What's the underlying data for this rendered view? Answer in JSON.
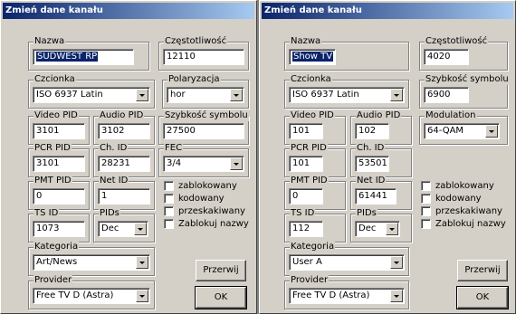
{
  "left": {
    "title": "Zmień dane kanału",
    "labels": {
      "nazwa": "Nazwa",
      "freq": "Częstotliwość",
      "czcionka": "Czcionka",
      "polar": "Polaryzacja",
      "video_pid": "Video PID",
      "audio_pid": "Audio PID",
      "symbol": "Szybkość symbolu",
      "pcr_pid": "PCR PID",
      "ch_id": "Ch. ID",
      "fec": "FEC",
      "pmt_pid": "PMT PID",
      "net_id": "Net ID",
      "ts_id": "TS ID",
      "pids": "PIDs",
      "kategoria": "Kategoria",
      "provider": "Provider"
    },
    "values": {
      "nazwa": "SÜDWEST RP",
      "freq": "12110",
      "czcionka": "ISO 6937 Latin",
      "polar": "hor",
      "video_pid": "3101",
      "audio_pid": "3102",
      "symbol": "27500",
      "pcr_pid": "3101",
      "ch_id": "28231",
      "fec": "3/4",
      "pmt_pid": "0",
      "net_id": "1",
      "ts_id": "1073",
      "pids": "Dec",
      "kategoria": "Art/News",
      "provider": "Free TV D (Astra)"
    },
    "checks": [
      "zablokowany",
      "kodowany",
      "przeskakiwany",
      "Zablokuj nazwy"
    ],
    "buttons": {
      "cancel": "Przerwij",
      "ok": "OK"
    }
  },
  "right": {
    "title": "Zmień dane kanału",
    "labels": {
      "nazwa": "Nazwa",
      "freq": "Częstotliwość",
      "czcionka": "Czcionka",
      "symbol": "Szybkość symbolu",
      "video_pid": "Video PID",
      "audio_pid": "Audio PID",
      "modulation": "Modulation",
      "pcr_pid": "PCR PID",
      "ch_id": "Ch. ID",
      "pmt_pid": "PMT PID",
      "net_id": "Net ID",
      "ts_id": "TS ID",
      "pids": "PIDs",
      "kategoria": "Kategoria",
      "provider": "Provider"
    },
    "values": {
      "nazwa": "Show TV",
      "freq": "4020",
      "czcionka": "ISO 6937 Latin",
      "symbol": "6900",
      "video_pid": "101",
      "audio_pid": "102",
      "modulation": "64-QAM",
      "pcr_pid": "101",
      "ch_id": "53501",
      "pmt_pid": "0",
      "net_id": "61441",
      "ts_id": "112",
      "pids": "Dec",
      "kategoria": "User A",
      "provider": "Free TV D (Astra)"
    },
    "checks": [
      "zablokowany",
      "kodowany",
      "przeskakiwany",
      "Zablokuj nazwy"
    ],
    "buttons": {
      "cancel": "Przerwij",
      "ok": "OK"
    }
  }
}
